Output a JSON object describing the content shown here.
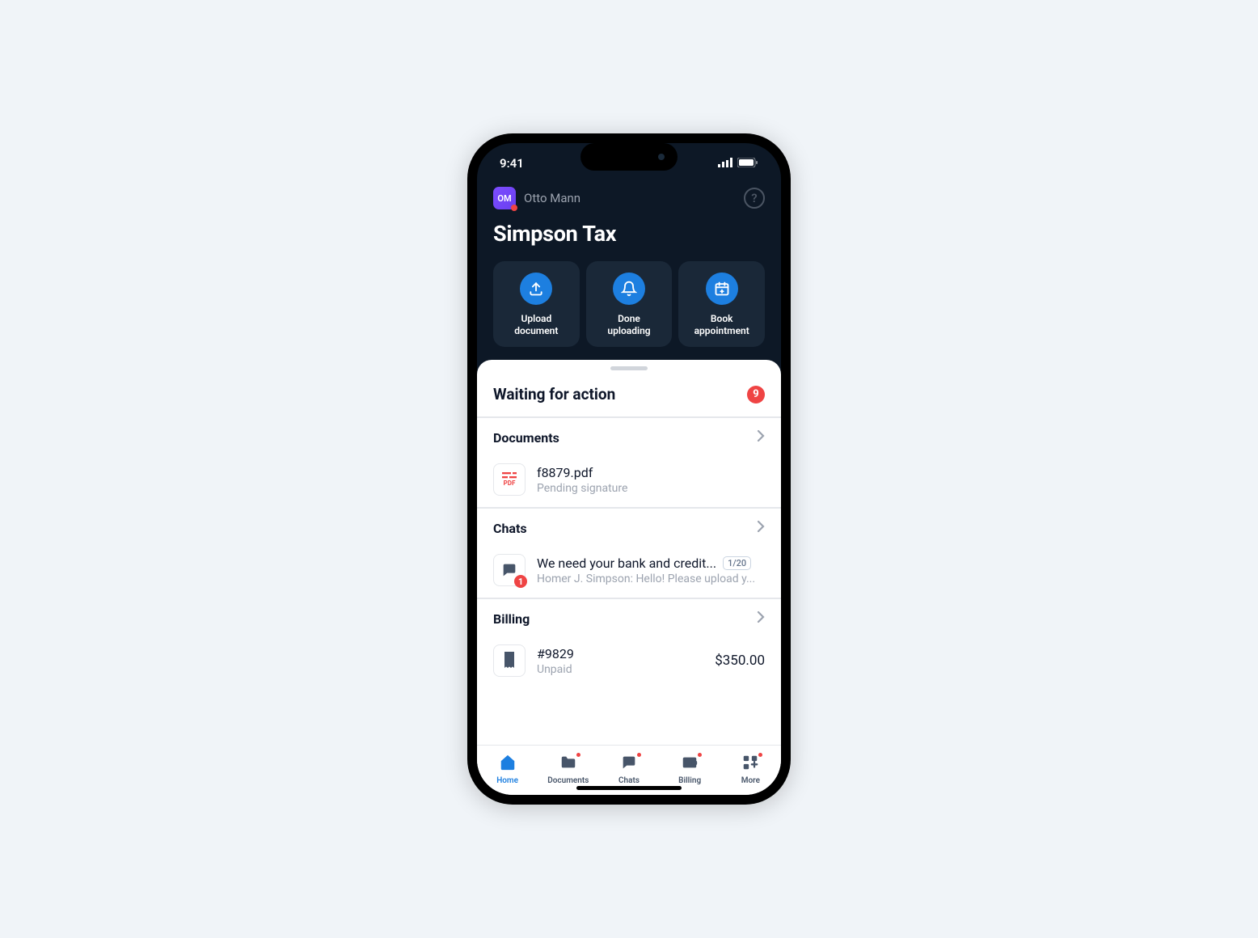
{
  "status_bar": {
    "time": "9:41"
  },
  "header": {
    "avatar_initials": "OM",
    "user_name": "Otto Mann",
    "app_title": "Simpson Tax"
  },
  "tiles": {
    "upload": "Upload document",
    "done": "Done uploading",
    "book": "Book appointment"
  },
  "sheet": {
    "heading": "Waiting for action",
    "count": "9",
    "documents": {
      "label": "Documents",
      "item": {
        "title": "f8879.pdf",
        "sub": "Pending signature"
      }
    },
    "chats": {
      "label": "Chats",
      "badge": "1",
      "item": {
        "title": "We need your bank and credit...",
        "date": "1/20",
        "sub": "Homer J. Simpson: Hello! Please upload y..."
      }
    },
    "billing": {
      "label": "Billing",
      "item": {
        "title": "#9829",
        "sub": "Unpaid",
        "amount": "$350.00"
      }
    }
  },
  "tabs": {
    "home": "Home",
    "documents": "Documents",
    "chats": "Chats",
    "billing": "Billing",
    "more": "More"
  }
}
